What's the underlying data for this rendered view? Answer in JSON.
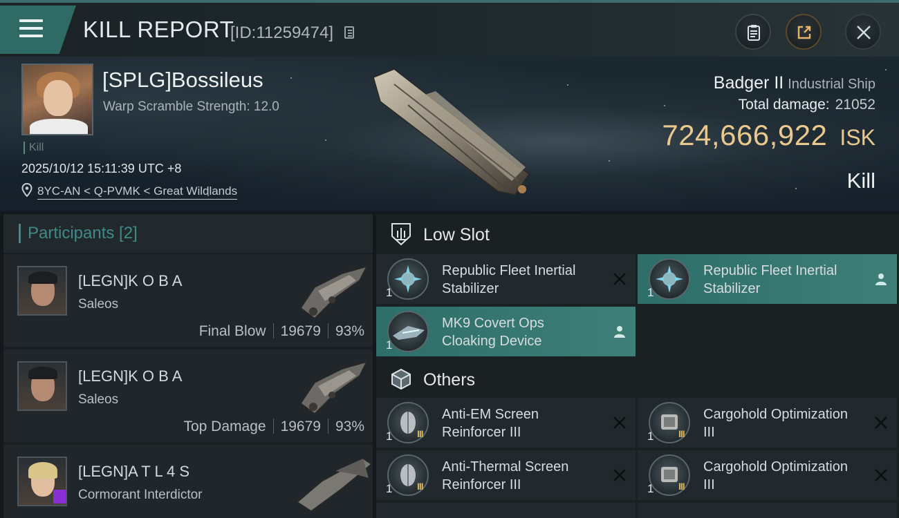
{
  "header": {
    "title": "KILL REPORT",
    "report_id": "[ID:11259474]"
  },
  "victim": {
    "name": "[SPLG]Bossileus",
    "warp_scramble": "Warp Scramble Strength: 12.0",
    "kill_tag": "Kill",
    "datetime": "2025/10/12 15:11:39 UTC +8",
    "location": "8YC-AN < Q-PVMK < Great Wildlands",
    "ship_name": "Badger II",
    "ship_class": "Industrial Ship",
    "damage_label": "Total damage:",
    "damage_value": "21052",
    "isk_value": "724,666,922",
    "isk_unit": "ISK",
    "kill_type": "Kill"
  },
  "participants": {
    "header": "Participants [2]",
    "rows": [
      {
        "name": "[LEGN]K O B A",
        "ship": "Saleos",
        "role": "Final Blow",
        "damage": "19679",
        "percent": "93%"
      },
      {
        "name": "[LEGN]K O B A",
        "ship": "Saleos",
        "role": "Top Damage",
        "damage": "19679",
        "percent": "93%"
      },
      {
        "name": "[LEGN]A T L 4 S",
        "ship": "Cormorant Interdictor"
      }
    ]
  },
  "modules": {
    "low_slot": {
      "label": "Low Slot",
      "items": [
        {
          "name": "Republic Fleet Inertial Stabilizer",
          "qty": "1",
          "status": "destroyed"
        },
        {
          "name": "Republic Fleet Inertial Stabilizer",
          "qty": "1",
          "status": "dropped"
        },
        {
          "name": "MK9 Covert Ops Cloaking Device",
          "qty": "1",
          "status": "dropped"
        }
      ]
    },
    "others": {
      "label": "Others",
      "items": [
        {
          "name": "Anti-EM Screen Reinforcer III",
          "qty": "1",
          "tier": "III",
          "status": "destroyed"
        },
        {
          "name": "Cargohold Optimization III",
          "qty": "1",
          "tier": "III",
          "status": "destroyed"
        },
        {
          "name": "Anti-Thermal Screen Reinforcer III",
          "qty": "1",
          "tier": "III",
          "status": "destroyed"
        },
        {
          "name": "Cargohold Optimization III",
          "qty": "1",
          "tier": "III",
          "status": "destroyed"
        }
      ]
    }
  },
  "colors": {
    "accent_teal": "#3f8a86",
    "isk_gold": "#e9c98d",
    "highlight": "#2e6e69"
  }
}
